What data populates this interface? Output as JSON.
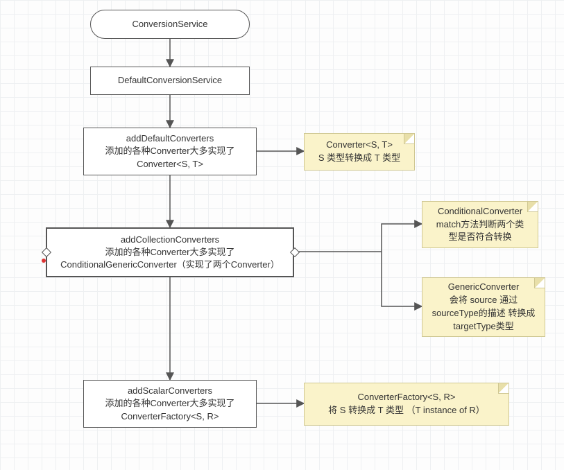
{
  "nodes": {
    "n1": {
      "label": "ConversionService"
    },
    "n2": {
      "label": "DefaultConversionService"
    },
    "n3": {
      "line1": "addDefaultConverters",
      "line2": "添加的各种Converter大多实现了",
      "line3": "Converter<S, T>"
    },
    "n4": {
      "line1": "addCollectionConverters",
      "line2": "添加的各种Converter大多实现了",
      "line3": "ConditionalGenericConverter（实现了两个Converter）"
    },
    "n5": {
      "line1": "addScalarConverters",
      "line2": "添加的各种Converter大多实现了",
      "line3": "ConverterFactory<S, R>"
    }
  },
  "notes": {
    "note1": {
      "line1": "Converter<S, T>",
      "line2": "S 类型转换成 T 类型"
    },
    "note2": {
      "line1": "ConditionalConverter",
      "line2": "match方法判断两个类",
      "line3": "型是否符合转换"
    },
    "note3": {
      "line1": "GenericConverter",
      "line2": "会将 source 通过",
      "line3": "sourceType的描述 转换成",
      "line4": "targetType类型"
    },
    "note4": {
      "line1": "ConverterFactory<S, R>",
      "line2": "将 S 转换成 T 类型 （T instance of R）"
    }
  }
}
